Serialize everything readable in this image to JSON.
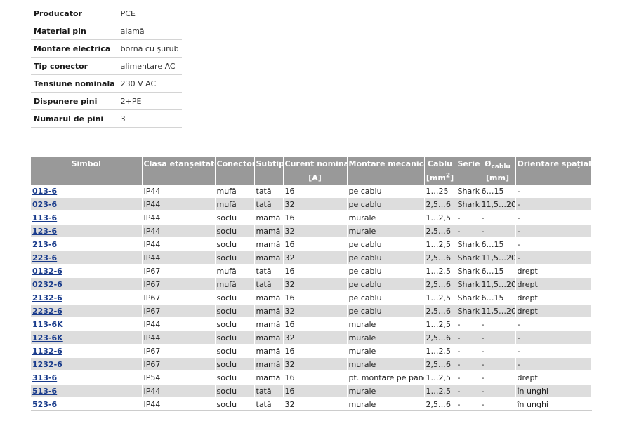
{
  "specs": [
    {
      "label": "Producător",
      "value": "PCE"
    },
    {
      "label": "Material pin",
      "value": "alamă"
    },
    {
      "label": "Montare electrică",
      "value": "bornă cu şurub"
    },
    {
      "label": "Tip conector",
      "value": "alimentare AC"
    },
    {
      "label": "Tensiune nominală",
      "value": "230 V AC"
    },
    {
      "label": "Dispunere pini",
      "value": "2+PE"
    },
    {
      "label": "Numărul de pini",
      "value": "3"
    }
  ],
  "products": {
    "headers": {
      "symbol": "Simbol",
      "seal_class": "Clasă etanşeitate",
      "connector": "Conector",
      "subtype": "Subtip",
      "current": "Curent nominal",
      "mounting": "Montare mecanică",
      "cable": "Cablu",
      "series": "Serie",
      "diameter_symbol": "Ø",
      "diameter_sub": "cablu",
      "orientation": "Orientare spaţială"
    },
    "units": {
      "current": "[A]",
      "cable_prefix": "[mm",
      "cable_sup": "2",
      "cable_suffix": "]",
      "diameter": "[mm]"
    },
    "rows": [
      [
        "013-6",
        "IP44",
        "mufă",
        "tată",
        "16",
        "pe cablu",
        "1…25",
        "Shark",
        "6…15",
        "-"
      ],
      [
        "023-6",
        "IP44",
        "mufă",
        "tată",
        "32",
        "pe cablu",
        "2,5…6",
        "Shark",
        "11,5…20",
        "-"
      ],
      [
        "113-6",
        "IP44",
        "soclu",
        "mamă",
        "16",
        "murale",
        "1…2,5",
        "-",
        "-",
        "-"
      ],
      [
        "123-6",
        "IP44",
        "soclu",
        "mamă",
        "32",
        "murale",
        "2,5…6",
        "-",
        "-",
        "-"
      ],
      [
        "213-6",
        "IP44",
        "soclu",
        "mamă",
        "16",
        "pe cablu",
        "1…2,5",
        "Shark",
        "6…15",
        "-"
      ],
      [
        "223-6",
        "IP44",
        "soclu",
        "mamă",
        "32",
        "pe cablu",
        "2,5…6",
        "Shark",
        "11,5…20",
        "-"
      ],
      [
        "0132-6",
        "IP67",
        "mufă",
        "tată",
        "16",
        "pe cablu",
        "1…2,5",
        "Shark",
        "6…15",
        "drept"
      ],
      [
        "0232-6",
        "IP67",
        "mufă",
        "tată",
        "32",
        "pe cablu",
        "2,5…6",
        "Shark",
        "11,5…20",
        "drept"
      ],
      [
        "2132-6",
        "IP67",
        "soclu",
        "mamă",
        "16",
        "pe cablu",
        "1…2,5",
        "Shark",
        "6…15",
        "drept"
      ],
      [
        "2232-6",
        "IP67",
        "soclu",
        "mamă",
        "32",
        "pe cablu",
        "2,5…6",
        "Shark",
        "11,5…20",
        "drept"
      ],
      [
        "113-6K",
        "IP44",
        "soclu",
        "mamă",
        "16",
        "murale",
        "1…2,5",
        "-",
        "-",
        "-"
      ],
      [
        "123-6K",
        "IP44",
        "soclu",
        "mamă",
        "32",
        "murale",
        "2,5…6",
        "-",
        "-",
        "-"
      ],
      [
        "1132-6",
        "IP67",
        "soclu",
        "mamă",
        "16",
        "murale",
        "1…2,5",
        "-",
        "-",
        "-"
      ],
      [
        "1232-6",
        "IP67",
        "soclu",
        "mamă",
        "32",
        "murale",
        "2,5…6",
        "-",
        "-",
        "-"
      ],
      [
        "313-6",
        "IP54",
        "soclu",
        "mamă",
        "16",
        "pt. montare pe panou",
        "1…2,5",
        "-",
        "-",
        "drept"
      ],
      [
        "513-6",
        "IP44",
        "soclu",
        "tată",
        "16",
        "murale",
        "1…2,5",
        "-",
        "-",
        "în unghi"
      ],
      [
        "523-6",
        "IP44",
        "soclu",
        "tată",
        "32",
        "murale",
        "2,5…6",
        "-",
        "-",
        "în unghi"
      ]
    ]
  }
}
